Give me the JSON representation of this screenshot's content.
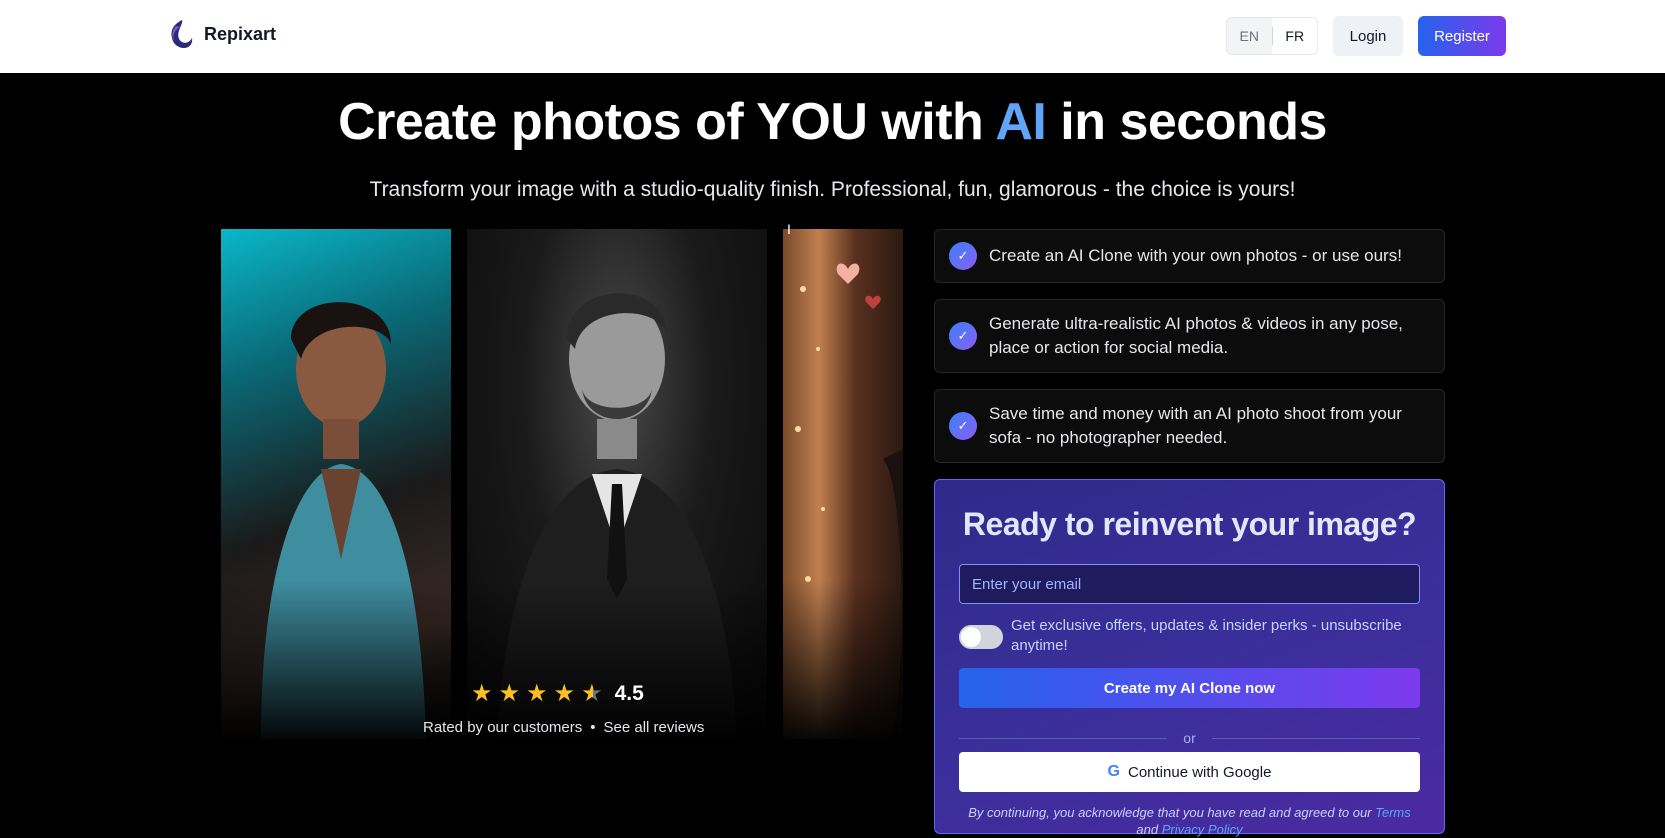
{
  "header": {
    "brand_name": "Repixart",
    "lang_en": "EN",
    "lang_fr": "FR",
    "login_label": "Login",
    "register_label": "Register"
  },
  "hero": {
    "headline_pre": "Create photos of YOU with ",
    "headline_ai": "AI",
    "headline_post": " in seconds",
    "subline": "Transform your image with a studio-quality finish. Professional, fun, glamorous - the choice is yours!"
  },
  "rating": {
    "value": "4.5",
    "rated_by": "Rated by our customers",
    "bullet": "•",
    "see_reviews": "See all reviews",
    "stars_filled": 4.5
  },
  "features": [
    {
      "text": "Create an AI Clone with your own photos - or use ours!"
    },
    {
      "text": "Generate ultra-realistic AI photos & videos in any pose, place or action for social media."
    },
    {
      "text": "Save time and money with an AI photo shoot from your sofa - no photographer needed."
    }
  ],
  "cta": {
    "title": "Ready to reinvent your image?",
    "email_placeholder": "Enter your email",
    "optin_text": "Get exclusive offers, updates & insider perks - unsubscribe anytime!",
    "create_button": "Create my AI Clone now",
    "or_label": "or",
    "google_button": "Continue with Google",
    "legal_pre": "By continuing, you acknowledge that you have read and agreed to our ",
    "terms": "Terms",
    "and": " and ",
    "privacy": "Privacy Policy"
  },
  "colors": {
    "accent_blue": "#2563eb",
    "accent_purple": "#7c3aed",
    "ai_highlight": "#60a5fa"
  }
}
